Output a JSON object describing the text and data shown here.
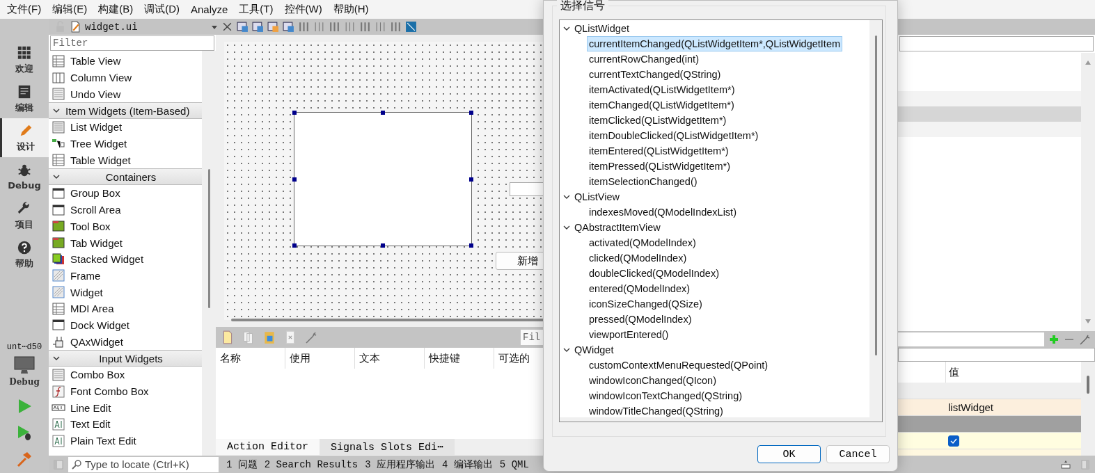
{
  "menu": [
    "文件(F)",
    "编辑(E)",
    "构建(B)",
    "调试(D)",
    "Analyze",
    "工具(T)",
    "控件(W)",
    "帮助(H)"
  ],
  "editor_toolbar": {
    "file_name": "widget.ui"
  },
  "mode_bar": {
    "modes": [
      {
        "label": "欢迎",
        "selected": false
      },
      {
        "label": "编辑",
        "selected": false
      },
      {
        "label": "设计",
        "selected": true
      },
      {
        "label": "Debug",
        "selected": false
      },
      {
        "label": "项目",
        "selected": false
      },
      {
        "label": "帮助",
        "selected": false
      }
    ],
    "kit": "unt⋯d50",
    "build": "Debug"
  },
  "widget_box": {
    "filter_placeholder": "Filter",
    "items_above": [
      "Table View",
      "Column View",
      "Undo View"
    ],
    "categories": [
      {
        "title": "Item Widgets (Item-Based)",
        "expanded": true,
        "items": [
          "List Widget",
          "Tree Widget",
          "Table Widget"
        ]
      },
      {
        "title": "Containers",
        "expanded": true,
        "items": [
          "Group Box",
          "Scroll Area",
          "Tool Box",
          "Tab Widget",
          "Stacked Widget",
          "Frame",
          "Widget",
          "MDI Area",
          "Dock Widget",
          "QAxWidget"
        ]
      },
      {
        "title": "Input Widgets",
        "expanded": true,
        "items": [
          "Combo Box",
          "Font Combo Box",
          "Line Edit",
          "Text Edit",
          "Plain Text Edit"
        ]
      }
    ]
  },
  "form": {
    "button": "新增"
  },
  "action_editor": {
    "filter_placeholder": "Fil",
    "columns": [
      "名称",
      "使用",
      "文本",
      "快捷键",
      "可选的"
    ],
    "tabs": [
      {
        "label": "Action Editor",
        "selected": true
      },
      {
        "label": "Signals  Slots Edi⋯",
        "selected": false
      }
    ]
  },
  "status_bar": {
    "locate_placeholder": "Type to locate (Ctrl+K)",
    "panes": [
      "1 问题",
      "2 Search Results",
      "3 应用程序输出",
      "4 编译输出",
      "5 QML"
    ]
  },
  "property_editor": {
    "value_header": "值",
    "rows": [
      {
        "kind": "group"
      },
      {
        "kind": "text",
        "value": "listWidget"
      },
      {
        "kind": "group"
      },
      {
        "kind": "check",
        "checked": true
      },
      {
        "kind": "partial"
      }
    ]
  },
  "dialog": {
    "title": "选择信号",
    "groups": [
      {
        "name": "QListWidget",
        "expanded": true,
        "signals": [
          {
            "label": "currentItemChanged(QListWidgetItem*,QListWidgetItem",
            "selected": true
          },
          {
            "label": "currentRowChanged(int)",
            "selected": false
          },
          {
            "label": "currentTextChanged(QString)",
            "selected": false
          },
          {
            "label": "itemActivated(QListWidgetItem*)",
            "selected": false
          },
          {
            "label": "itemChanged(QListWidgetItem*)",
            "selected": false
          },
          {
            "label": "itemClicked(QListWidgetItem*)",
            "selected": false
          },
          {
            "label": "itemDoubleClicked(QListWidgetItem*)",
            "selected": false
          },
          {
            "label": "itemEntered(QListWidgetItem*)",
            "selected": false
          },
          {
            "label": "itemPressed(QListWidgetItem*)",
            "selected": false
          },
          {
            "label": "itemSelectionChanged()",
            "selected": false
          }
        ]
      },
      {
        "name": "QListView",
        "expanded": true,
        "signals": [
          {
            "label": "indexesMoved(QModelIndexList)",
            "selected": false
          }
        ]
      },
      {
        "name": "QAbstractItemView",
        "expanded": true,
        "signals": [
          {
            "label": "activated(QModelIndex)",
            "selected": false
          },
          {
            "label": "clicked(QModelIndex)",
            "selected": false
          },
          {
            "label": "doubleClicked(QModelIndex)",
            "selected": false
          },
          {
            "label": "entered(QModelIndex)",
            "selected": false
          },
          {
            "label": "iconSizeChanged(QSize)",
            "selected": false
          },
          {
            "label": "pressed(QModelIndex)",
            "selected": false
          },
          {
            "label": "viewportEntered()",
            "selected": false
          }
        ]
      },
      {
        "name": "QWidget",
        "expanded": true,
        "signals": [
          {
            "label": "customContextMenuRequested(QPoint)",
            "selected": false
          },
          {
            "label": "windowIconChanged(QIcon)",
            "selected": false
          },
          {
            "label": "windowIconTextChanged(QString)",
            "selected": false
          },
          {
            "label": "windowTitleChanged(QString)",
            "selected": false
          }
        ]
      }
    ],
    "buttons": [
      "OK",
      "Cancel"
    ]
  }
}
